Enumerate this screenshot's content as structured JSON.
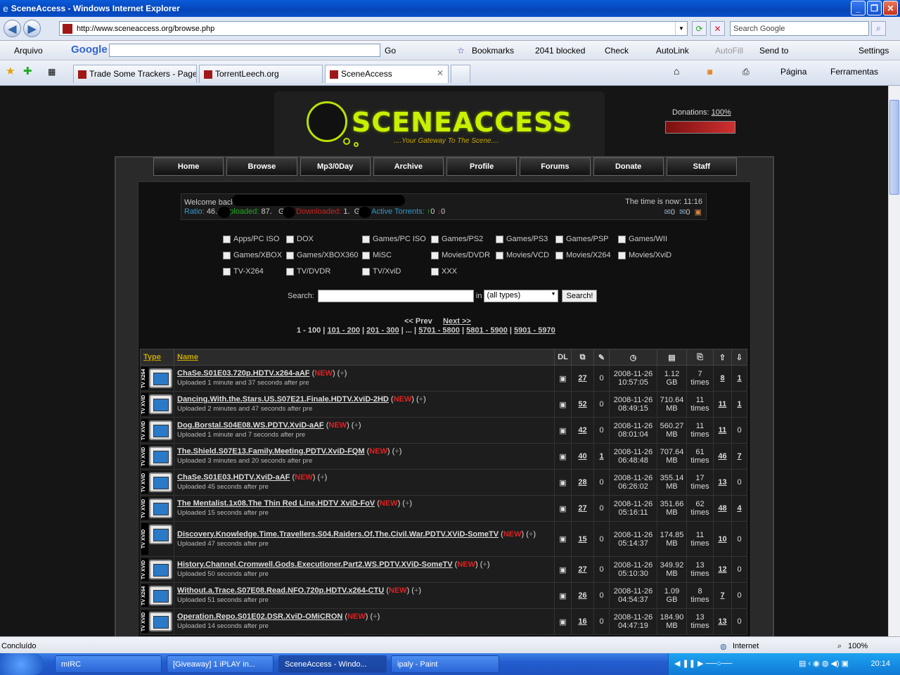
{
  "window": {
    "title": "SceneAccess - Windows Internet Explorer"
  },
  "address": {
    "url": "http://www.sceneaccess.org/browse.php",
    "search_placeholder": "Search Google"
  },
  "toolbar": {
    "arquivo": "Arquivo",
    "google": "Google",
    "go": "Go",
    "bookmarks": "Bookmarks",
    "blocked": "2041 blocked",
    "check": "Check",
    "autolink": "AutoLink",
    "autofill": "AutoFill",
    "sendto": "Send to",
    "settings": "Settings"
  },
  "tabs": [
    {
      "label": "Trade Some Trackers - Page ..."
    },
    {
      "label": "TorrentLeech.org"
    },
    {
      "label": "SceneAccess"
    }
  ],
  "favbar_right": {
    "pagina": "Página",
    "ferramentas": "Ferramentas"
  },
  "site": {
    "logo": "SCENEACCESS",
    "slogan": "....Your Gateway To The Scene....",
    "donations_label": "Donations:",
    "donations_value": "100%",
    "menu": [
      "Home",
      "Browse",
      "Mp3/0Day",
      "Archive",
      "Profile",
      "Forums",
      "Donate",
      "Staff"
    ]
  },
  "welcome": {
    "greeting": "Welcome back,",
    "ratio_label": "Ratio:",
    "ratio": "46.",
    "uploaded_label": "Uploaded:",
    "uploaded": "87.",
    "uploaded_unit": "GB",
    "downloaded_label": "Downloaded:",
    "downloaded": "1.",
    "downloaded_unit": "GB",
    "active_label": "Active Torrents:",
    "active_up": "0",
    "active_down": "0",
    "time": "The time is now: 11:16",
    "msg1": "0",
    "msg2": "0"
  },
  "categories": [
    "Apps/PC ISO",
    "DOX",
    "Games/PC ISO",
    "Games/PS2",
    "Games/PS3",
    "Games/PSP",
    "Games/WII",
    "Games/XBOX",
    "Games/XBOX360",
    "MiSC",
    "Movies/DVDR",
    "Movies/VCD",
    "Movies/X264",
    "Movies/XviD",
    "TV-X264",
    "TV/DVDR",
    "TV/XviD",
    "XXX"
  ],
  "search": {
    "label": "Search:",
    "in": "in",
    "type": "(all types)",
    "button": "Search!"
  },
  "pager": {
    "prev": "<< Prev",
    "next": "Next >>",
    "pages": [
      "1 - 100",
      "101 - 200",
      "201 - 300",
      "5701 - 5800",
      "5801 - 5900",
      "5901 - 5970"
    ]
  },
  "table": {
    "headers": {
      "type": "Type",
      "name": "Name",
      "dl": "DL"
    },
    "rows": [
      {
        "cat": "TV X264",
        "name": "ChaSe.S01E03.720p.HDTV.x264-aAF",
        "sub": "Uploaded 1 minute and 37 seconds after pre",
        "files": "27",
        "comments": "0",
        "date": "2008-11-26",
        "time": "10:57:05",
        "size": "1.12",
        "unit": "GB",
        "snatched": "7",
        "seeders": "8",
        "leechers": "1"
      },
      {
        "cat": "TV XVID",
        "name": "Dancing.With.the.Stars.US.S07E21.Finale.HDTV.XviD-2HD",
        "sub": "Uploaded 2 minutes and 47 seconds after pre",
        "files": "52",
        "comments": "0",
        "date": "2008-11-26",
        "time": "08:49:15",
        "size": "710.64",
        "unit": "MB",
        "snatched": "11",
        "seeders": "11",
        "leechers": "1"
      },
      {
        "cat": "TV XVID",
        "name": "Dog.Borstal.S04E08.WS.PDTV.XviD-aAF",
        "sub": "Uploaded 1 minute and 7 seconds after pre",
        "files": "42",
        "comments": "0",
        "date": "2008-11-26",
        "time": "08:01:04",
        "size": "560.27",
        "unit": "MB",
        "snatched": "11",
        "seeders": "11",
        "leechers": "0"
      },
      {
        "cat": "TV XVID",
        "name": "The.Shield.S07E13.Family.Meeting.PDTV.XviD-FQM",
        "sub": "Uploaded 3 minutes and 20 seconds after pre",
        "files": "40",
        "comments": "1",
        "date": "2008-11-26",
        "time": "06:48:48",
        "size": "707.64",
        "unit": "MB",
        "snatched": "61",
        "seeders": "46",
        "leechers": "7"
      },
      {
        "cat": "TV XVID",
        "name": "ChaSe.S01E03.HDTV.XviD-aAF",
        "sub": "Uploaded 45 seconds after pre",
        "files": "28",
        "comments": "0",
        "date": "2008-11-26",
        "time": "06:26:02",
        "size": "355.14",
        "unit": "MB",
        "snatched": "17",
        "seeders": "13",
        "leechers": "0"
      },
      {
        "cat": "TV XVID",
        "name": "The Mentalist.1x08.The Thin Red Line.HDTV XviD-FoV",
        "sub": "Uploaded 15 seconds after pre",
        "files": "27",
        "comments": "0",
        "date": "2008-11-26",
        "time": "05:16:11",
        "size": "351.66",
        "unit": "MB",
        "snatched": "62",
        "seeders": "48",
        "leechers": "4"
      },
      {
        "cat": "TV XVID",
        "name": "Discovery.Knowledge.Time.Travellers.S04.Raiders.Of.The.Civil.War.PDTV.XViD-SomeTV",
        "sub": "Uploaded 47 seconds after pre",
        "files": "15",
        "comments": "0",
        "date": "2008-11-26",
        "time": "05:14:37",
        "size": "174.85",
        "unit": "MB",
        "snatched": "11",
        "seeders": "10",
        "leechers": "0",
        "tall": true
      },
      {
        "cat": "TV XVID",
        "name": "History.Channel.Cromwell.Gods.Executioner.Part2.WS.PDTV.XViD-SomeTV",
        "sub": "Uploaded 50 seconds after pre",
        "files": "27",
        "comments": "0",
        "date": "2008-11-26",
        "time": "05:10:30",
        "size": "349.92",
        "unit": "MB",
        "snatched": "13",
        "seeders": "12",
        "leechers": "0"
      },
      {
        "cat": "TV X264",
        "name": "Without.a.Trace.S07E08.Read.NFO.720p.HDTV.x264-CTU",
        "sub": "Uploaded 51 seconds after pre",
        "files": "26",
        "comments": "0",
        "date": "2008-11-26",
        "time": "04:54:37",
        "size": "1.09",
        "unit": "GB",
        "snatched": "8",
        "seeders": "7",
        "leechers": "0"
      },
      {
        "cat": "TV XVID",
        "name": "Operation.Repo.S01E02.DSR.XviD-OMiCRON",
        "sub": "Uploaded 14 seconds after pre",
        "files": "16",
        "comments": "0",
        "date": "2008-11-26",
        "time": "04:47:19",
        "size": "184.90",
        "unit": "MB",
        "snatched": "13",
        "seeders": "13",
        "leechers": "0"
      }
    ],
    "new_label": "NEW",
    "times_label": "times"
  },
  "statusbar": {
    "left": "Concluído",
    "zone": "Internet",
    "zoom": "100%"
  },
  "taskbar": {
    "items": [
      "mIRC",
      "[Giveaway] 1 iPLAY in...",
      "SceneAccess - Windo...",
      "ipaly - Paint"
    ],
    "clock": "20:14"
  }
}
